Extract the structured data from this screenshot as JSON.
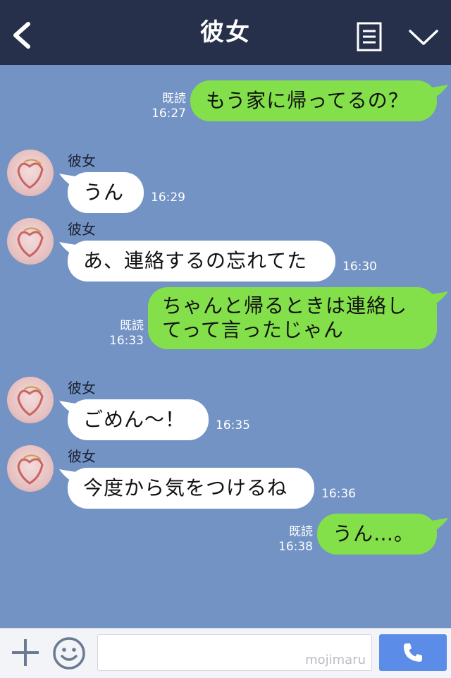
{
  "header": {
    "title": "彼女",
    "back_icon": "chevron-left-icon",
    "menu_icon": "notes-icon",
    "dropdown_icon": "chevron-down-icon"
  },
  "messages": [
    {
      "from": "me",
      "text": "もう家に帰ってるの？",
      "read": "既読",
      "time": "16:27"
    },
    {
      "from": "her",
      "sender": "彼女",
      "text": "うん",
      "time": "16:29"
    },
    {
      "from": "her",
      "sender": "彼女",
      "text": "あ、連絡するの忘れてた",
      "time": "16:30"
    },
    {
      "from": "me",
      "text": "ちゃんと帰るときは連絡してって言ったじゃん",
      "read": "既読",
      "time": "16:33"
    },
    {
      "from": "her",
      "sender": "彼女",
      "text": "ごめん〜！",
      "time": "16:35"
    },
    {
      "from": "her",
      "sender": "彼女",
      "text": "今度から気をつけるね",
      "time": "16:36"
    },
    {
      "from": "me",
      "text": "うん…。",
      "read": "既読",
      "time": "16:38"
    }
  ],
  "footer": {
    "watermark": "mojimaru",
    "input_value": ""
  },
  "colors": {
    "header_bg": "#26304a",
    "chat_bg": "#7293c4",
    "my_bubble": "#84e04a",
    "her_bubble": "#ffffff",
    "call_button": "#5a8ce8"
  }
}
